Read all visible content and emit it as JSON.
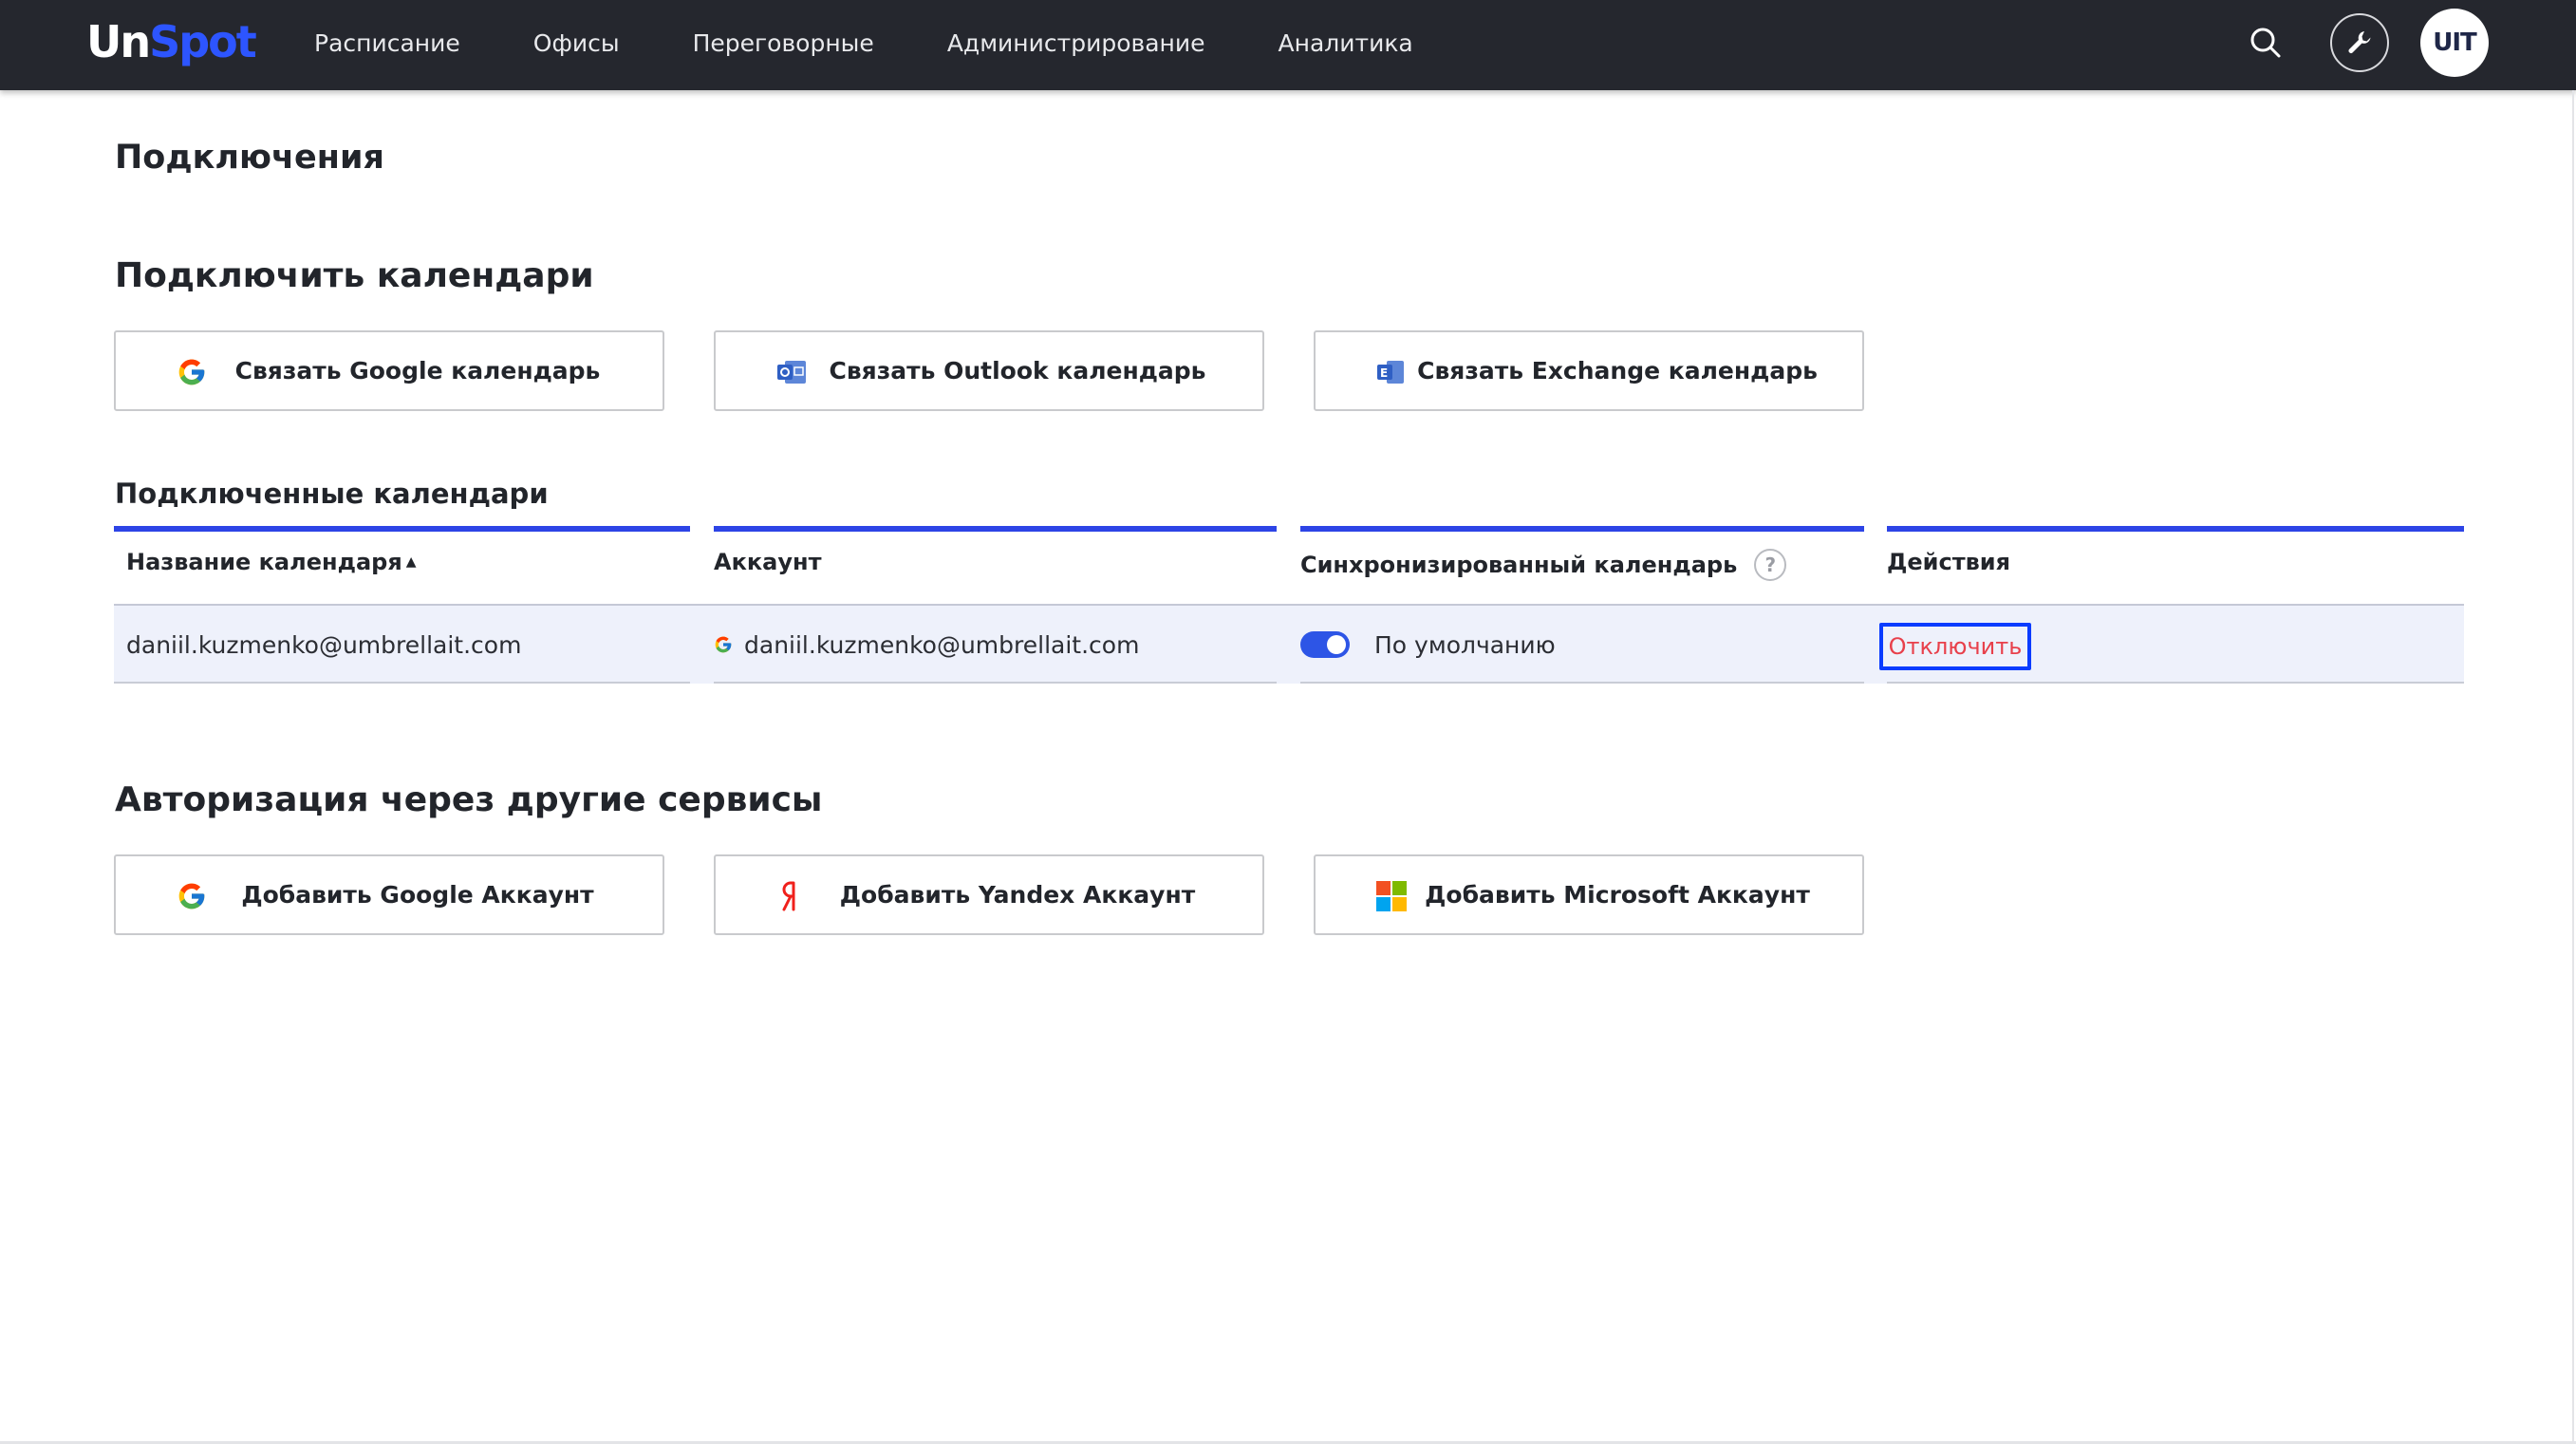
{
  "header": {
    "logo_un": "Un",
    "logo_spot": "Spot",
    "nav": [
      "Расписание",
      "Офисы",
      "Переговорные",
      "Администрирование",
      "Аналитика"
    ],
    "avatar_text": "UIT"
  },
  "page": {
    "title": "Подключения",
    "connect_section_title": "Подключить календари",
    "connect_buttons": {
      "google": "Связать Google календарь",
      "outlook": "Связать Outlook календарь",
      "exchange": "Связать Exchange календарь"
    },
    "connected_title": "Подключенные календари",
    "table": {
      "headers": {
        "name": "Название календаря",
        "account": "Аккаунт",
        "synced": "Синхронизированный календарь",
        "actions": "Действия"
      },
      "help_symbol": "?",
      "rows": [
        {
          "name": "daniil.kuzmenko@umbrellait.com",
          "account": "daniil.kuzmenko@umbrellait.com",
          "synced_label": "По умолчанию",
          "synced_on": true,
          "action": "Отключить"
        }
      ]
    },
    "auth_section_title": "Авторизация через другие сервисы",
    "auth_buttons": {
      "google": "Добавить Google Аккаунт",
      "yandex": "Добавить Yandex Аккаунт",
      "microsoft": "Добавить Microsoft Аккаунт"
    }
  },
  "colors": {
    "topbar": "#25272e",
    "accent": "#2d44e6",
    "danger": "#e8404b"
  }
}
